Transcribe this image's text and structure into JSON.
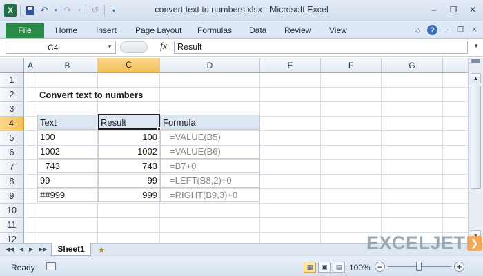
{
  "window": {
    "title": "convert text to numbers.xlsx - Microsoft Excel",
    "app_icon_letter": "X"
  },
  "ribbon": {
    "tabs": [
      "File",
      "Home",
      "Insert",
      "Page Layout",
      "Formulas",
      "Data",
      "Review",
      "View"
    ]
  },
  "formula_bar": {
    "name_box": "C4",
    "fx_label": "fx",
    "content": "Result"
  },
  "grid": {
    "columns": [
      "A",
      "B",
      "C",
      "D",
      "E",
      "F",
      "G"
    ],
    "active_column": "C",
    "rows": [
      "1",
      "2",
      "3",
      "4",
      "5",
      "6",
      "7",
      "8",
      "9",
      "10",
      "11",
      "12"
    ],
    "active_row": "4",
    "heading": "Convert text to numbers",
    "table": {
      "headers": [
        "Text",
        "Result",
        "Formula"
      ],
      "rows": [
        {
          "text": "100",
          "result": "100",
          "formula": "=VALUE(B5)"
        },
        {
          "text": "1002",
          "result": "1002",
          "formula": "=VALUE(B6)"
        },
        {
          "text": "  743",
          "result": "743",
          "formula": "=B7+0"
        },
        {
          "text": "99-",
          "result": "99",
          "formula": "=LEFT(B8,2)+0"
        },
        {
          "text": "##999",
          "result": "999",
          "formula": "=RIGHT(B9,3)+0"
        }
      ]
    }
  },
  "sheets": {
    "active": "Sheet1"
  },
  "logo": {
    "text": "EXCELJET"
  },
  "status_bar": {
    "status": "Ready",
    "zoom_label": "100%",
    "zoom_percent": 100
  }
}
